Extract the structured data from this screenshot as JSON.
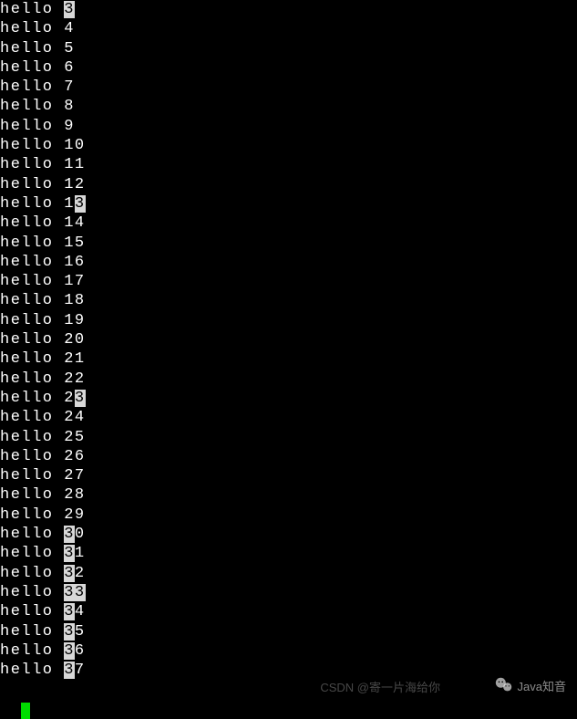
{
  "terminal": {
    "prefix": "hello ",
    "lines": [
      {
        "segments": [
          {
            "t": "hello ",
            "hl": false
          },
          {
            "t": "3",
            "hl": true
          }
        ]
      },
      {
        "segments": [
          {
            "t": "hello 4",
            "hl": false
          }
        ]
      },
      {
        "segments": [
          {
            "t": "hello 5",
            "hl": false
          }
        ]
      },
      {
        "segments": [
          {
            "t": "hello 6",
            "hl": false
          }
        ]
      },
      {
        "segments": [
          {
            "t": "hello 7",
            "hl": false
          }
        ]
      },
      {
        "segments": [
          {
            "t": "hello 8",
            "hl": false
          }
        ]
      },
      {
        "segments": [
          {
            "t": "hello 9",
            "hl": false
          }
        ]
      },
      {
        "segments": [
          {
            "t": "hello 10",
            "hl": false
          }
        ]
      },
      {
        "segments": [
          {
            "t": "hello 11",
            "hl": false
          }
        ]
      },
      {
        "segments": [
          {
            "t": "hello 12",
            "hl": false
          }
        ]
      },
      {
        "segments": [
          {
            "t": "hello 1",
            "hl": false
          },
          {
            "t": "3",
            "hl": true
          }
        ]
      },
      {
        "segments": [
          {
            "t": "hello 14",
            "hl": false
          }
        ]
      },
      {
        "segments": [
          {
            "t": "hello 15",
            "hl": false
          }
        ]
      },
      {
        "segments": [
          {
            "t": "hello 16",
            "hl": false
          }
        ]
      },
      {
        "segments": [
          {
            "t": "hello 17",
            "hl": false
          }
        ]
      },
      {
        "segments": [
          {
            "t": "hello 18",
            "hl": false
          }
        ]
      },
      {
        "segments": [
          {
            "t": "hello 19",
            "hl": false
          }
        ]
      },
      {
        "segments": [
          {
            "t": "hello 20",
            "hl": false
          }
        ]
      },
      {
        "segments": [
          {
            "t": "hello 21",
            "hl": false
          }
        ]
      },
      {
        "segments": [
          {
            "t": "hello 22",
            "hl": false
          }
        ]
      },
      {
        "segments": [
          {
            "t": "hello 2",
            "hl": false
          },
          {
            "t": "3",
            "hl": true
          }
        ]
      },
      {
        "segments": [
          {
            "t": "hello 24",
            "hl": false
          }
        ]
      },
      {
        "segments": [
          {
            "t": "hello 25",
            "hl": false
          }
        ]
      },
      {
        "segments": [
          {
            "t": "hello 26",
            "hl": false
          }
        ]
      },
      {
        "segments": [
          {
            "t": "hello 27",
            "hl": false
          }
        ]
      },
      {
        "segments": [
          {
            "t": "hello 28",
            "hl": false
          }
        ]
      },
      {
        "segments": [
          {
            "t": "hello 29",
            "hl": false
          }
        ]
      },
      {
        "segments": [
          {
            "t": "hello ",
            "hl": false
          },
          {
            "t": "3",
            "hl": true
          },
          {
            "t": "0",
            "hl": false
          }
        ]
      },
      {
        "segments": [
          {
            "t": "hello ",
            "hl": false
          },
          {
            "t": "3",
            "hl": true
          },
          {
            "t": "1",
            "hl": false
          }
        ]
      },
      {
        "segments": [
          {
            "t": "hello ",
            "hl": false
          },
          {
            "t": "3",
            "hl": true
          },
          {
            "t": "2",
            "hl": false
          }
        ]
      },
      {
        "segments": [
          {
            "t": "hello ",
            "hl": false
          },
          {
            "t": "33",
            "hl": true
          }
        ]
      },
      {
        "segments": [
          {
            "t": "hello ",
            "hl": false
          },
          {
            "t": "3",
            "hl": true
          },
          {
            "t": "4",
            "hl": false
          }
        ]
      },
      {
        "segments": [
          {
            "t": "hello ",
            "hl": false
          },
          {
            "t": "3",
            "hl": true
          },
          {
            "t": "5",
            "hl": false
          }
        ]
      },
      {
        "segments": [
          {
            "t": "hello ",
            "hl": false
          },
          {
            "t": "3",
            "hl": true
          },
          {
            "t": "6",
            "hl": false
          }
        ]
      },
      {
        "segments": [
          {
            "t": "hello ",
            "hl": false
          },
          {
            "t": "3",
            "hl": true
          },
          {
            "t": "7",
            "hl": false
          }
        ]
      }
    ]
  },
  "watermarks": {
    "csdn": "CSDN @寄一片海给你",
    "wechat_label": "Java知音"
  }
}
